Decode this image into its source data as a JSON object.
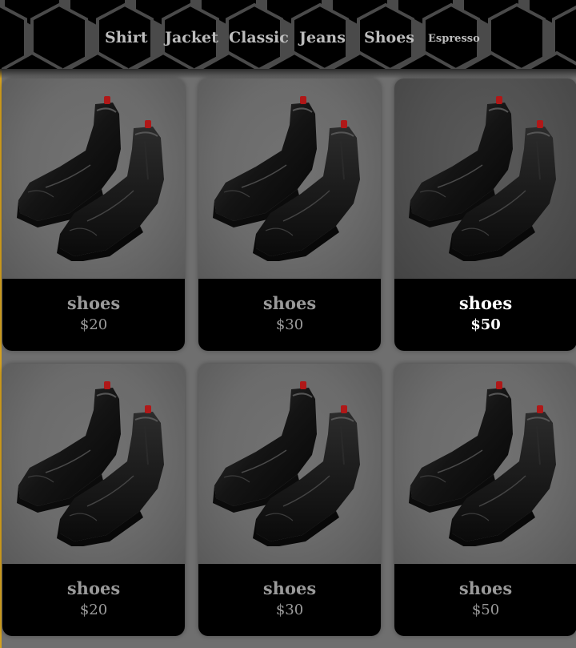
{
  "nav": {
    "items": [
      {
        "label": "Shirt"
      },
      {
        "label": "Jacket"
      },
      {
        "label": "Classic"
      },
      {
        "label": "Jeans"
      },
      {
        "label": "Shoes"
      },
      {
        "label": "Espresso"
      }
    ]
  },
  "products": [
    {
      "name": "shoes",
      "price": "$20",
      "active": false
    },
    {
      "name": "shoes",
      "price": "$30",
      "active": false
    },
    {
      "name": "shoes",
      "price": "$50",
      "active": true
    },
    {
      "name": "shoes",
      "price": "$20",
      "active": false
    },
    {
      "name": "shoes",
      "price": "$30",
      "active": false
    },
    {
      "name": "shoes",
      "price": "$50",
      "active": false
    }
  ],
  "colors": {
    "accent": "#d6a21e",
    "page_background": "#6f6f6f",
    "info_bar": "#000000",
    "muted_text": "#9a9a9a"
  }
}
